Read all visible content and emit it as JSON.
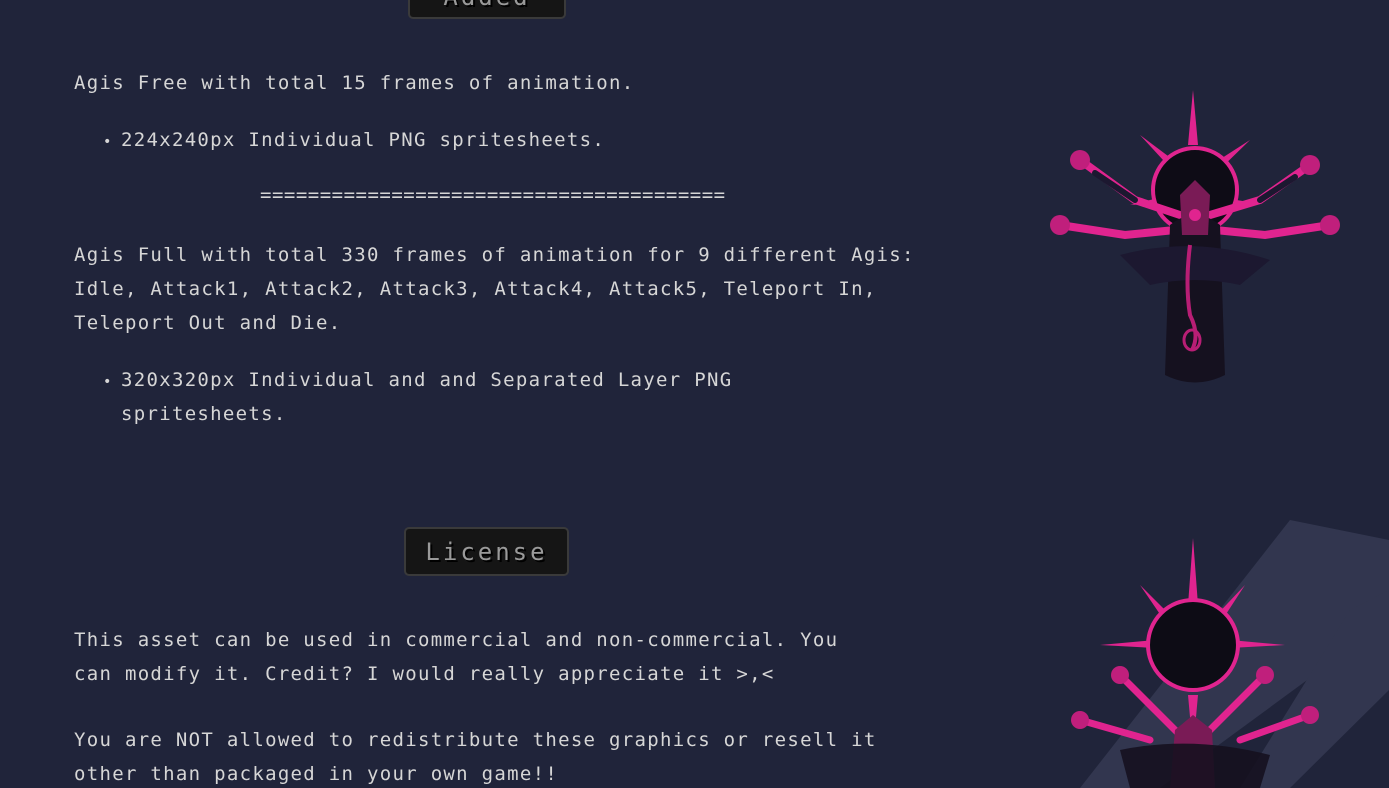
{
  "headers": {
    "top_partial": "Added",
    "license": "License"
  },
  "free": {
    "intro": "Agis Free with total 15 frames of animation.",
    "bullet": "224x240px Individual PNG spritesheets."
  },
  "separator": "=======================================",
  "full": {
    "intro_lines": [
      "Agis Full with total 330 frames of animation for 9 different Agis:",
      "Idle, Attack1, Attack2, Attack3, Attack4, Attack5, Teleport In,",
      "Teleport Out and Die."
    ],
    "bullet_lines": [
      "320x320px Individual and and Separated Layer PNG",
      "spritesheets."
    ]
  },
  "license": {
    "para1_lines": [
      "This asset can be used in commercial and non-commercial. You",
      "can modify it. Credit? I would really appreciate it >,<"
    ],
    "para2_lines": [
      "You are NOT allowed to redistribute these graphics or resell it",
      "other than packaged in your own game!!"
    ]
  },
  "images": {
    "top": "agis-boss-sprite",
    "bottom": "agis-boss-sprite-teleport"
  },
  "colors": {
    "background": "#20243a",
    "text": "#d6d6d6",
    "accent_magenta": "#e0248f"
  }
}
